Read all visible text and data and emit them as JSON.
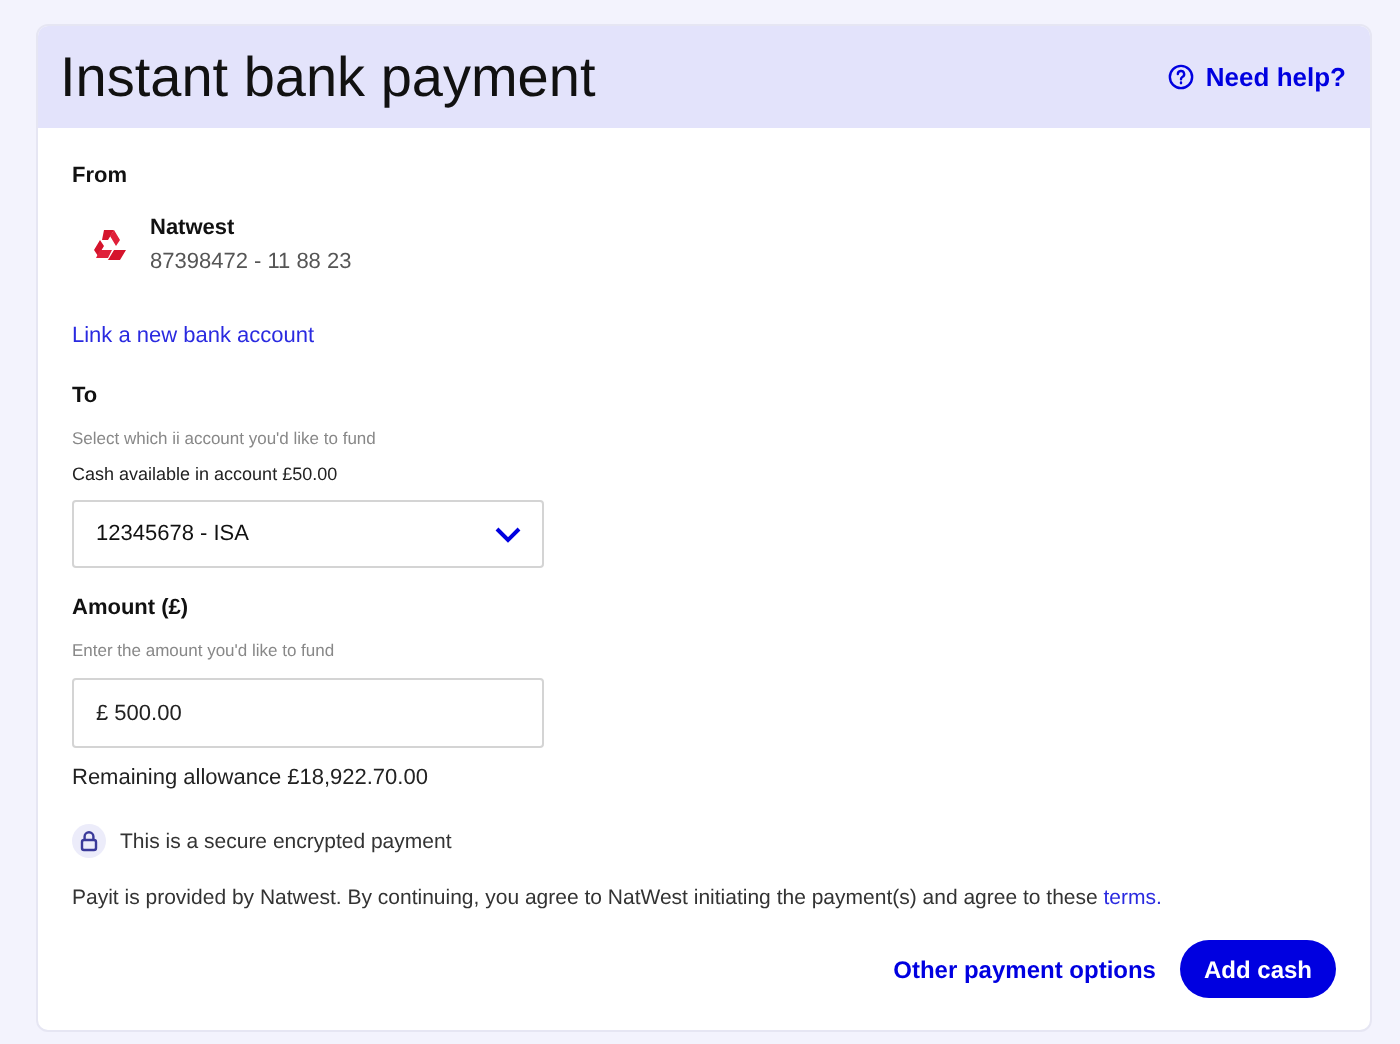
{
  "header": {
    "title": "Instant bank payment",
    "help": "Need help?"
  },
  "from": {
    "label": "From",
    "bank": "Natwest",
    "account": "87398472 - 11 88 23",
    "link": "Link a new bank account"
  },
  "to": {
    "label": "To",
    "hint": "Select which ii account you'd like to fund",
    "cash": "Cash available in account £50.00",
    "value": "12345678 - ISA"
  },
  "amount": {
    "label": "Amount (£)",
    "hint": "Enter the amount you'd like to fund",
    "value": "£ 500.00",
    "allowance": "Remaining allowance £18,922.70.00"
  },
  "secure": "This is a secure encrypted payment",
  "notice": {
    "text": "Payit is provided by Natwest. By continuing, you agree to NatWest initiating the payment(s) and agree to these",
    "link": "terms."
  },
  "buttons": {
    "secondary": "Other payment options",
    "primary": "Add cash"
  }
}
